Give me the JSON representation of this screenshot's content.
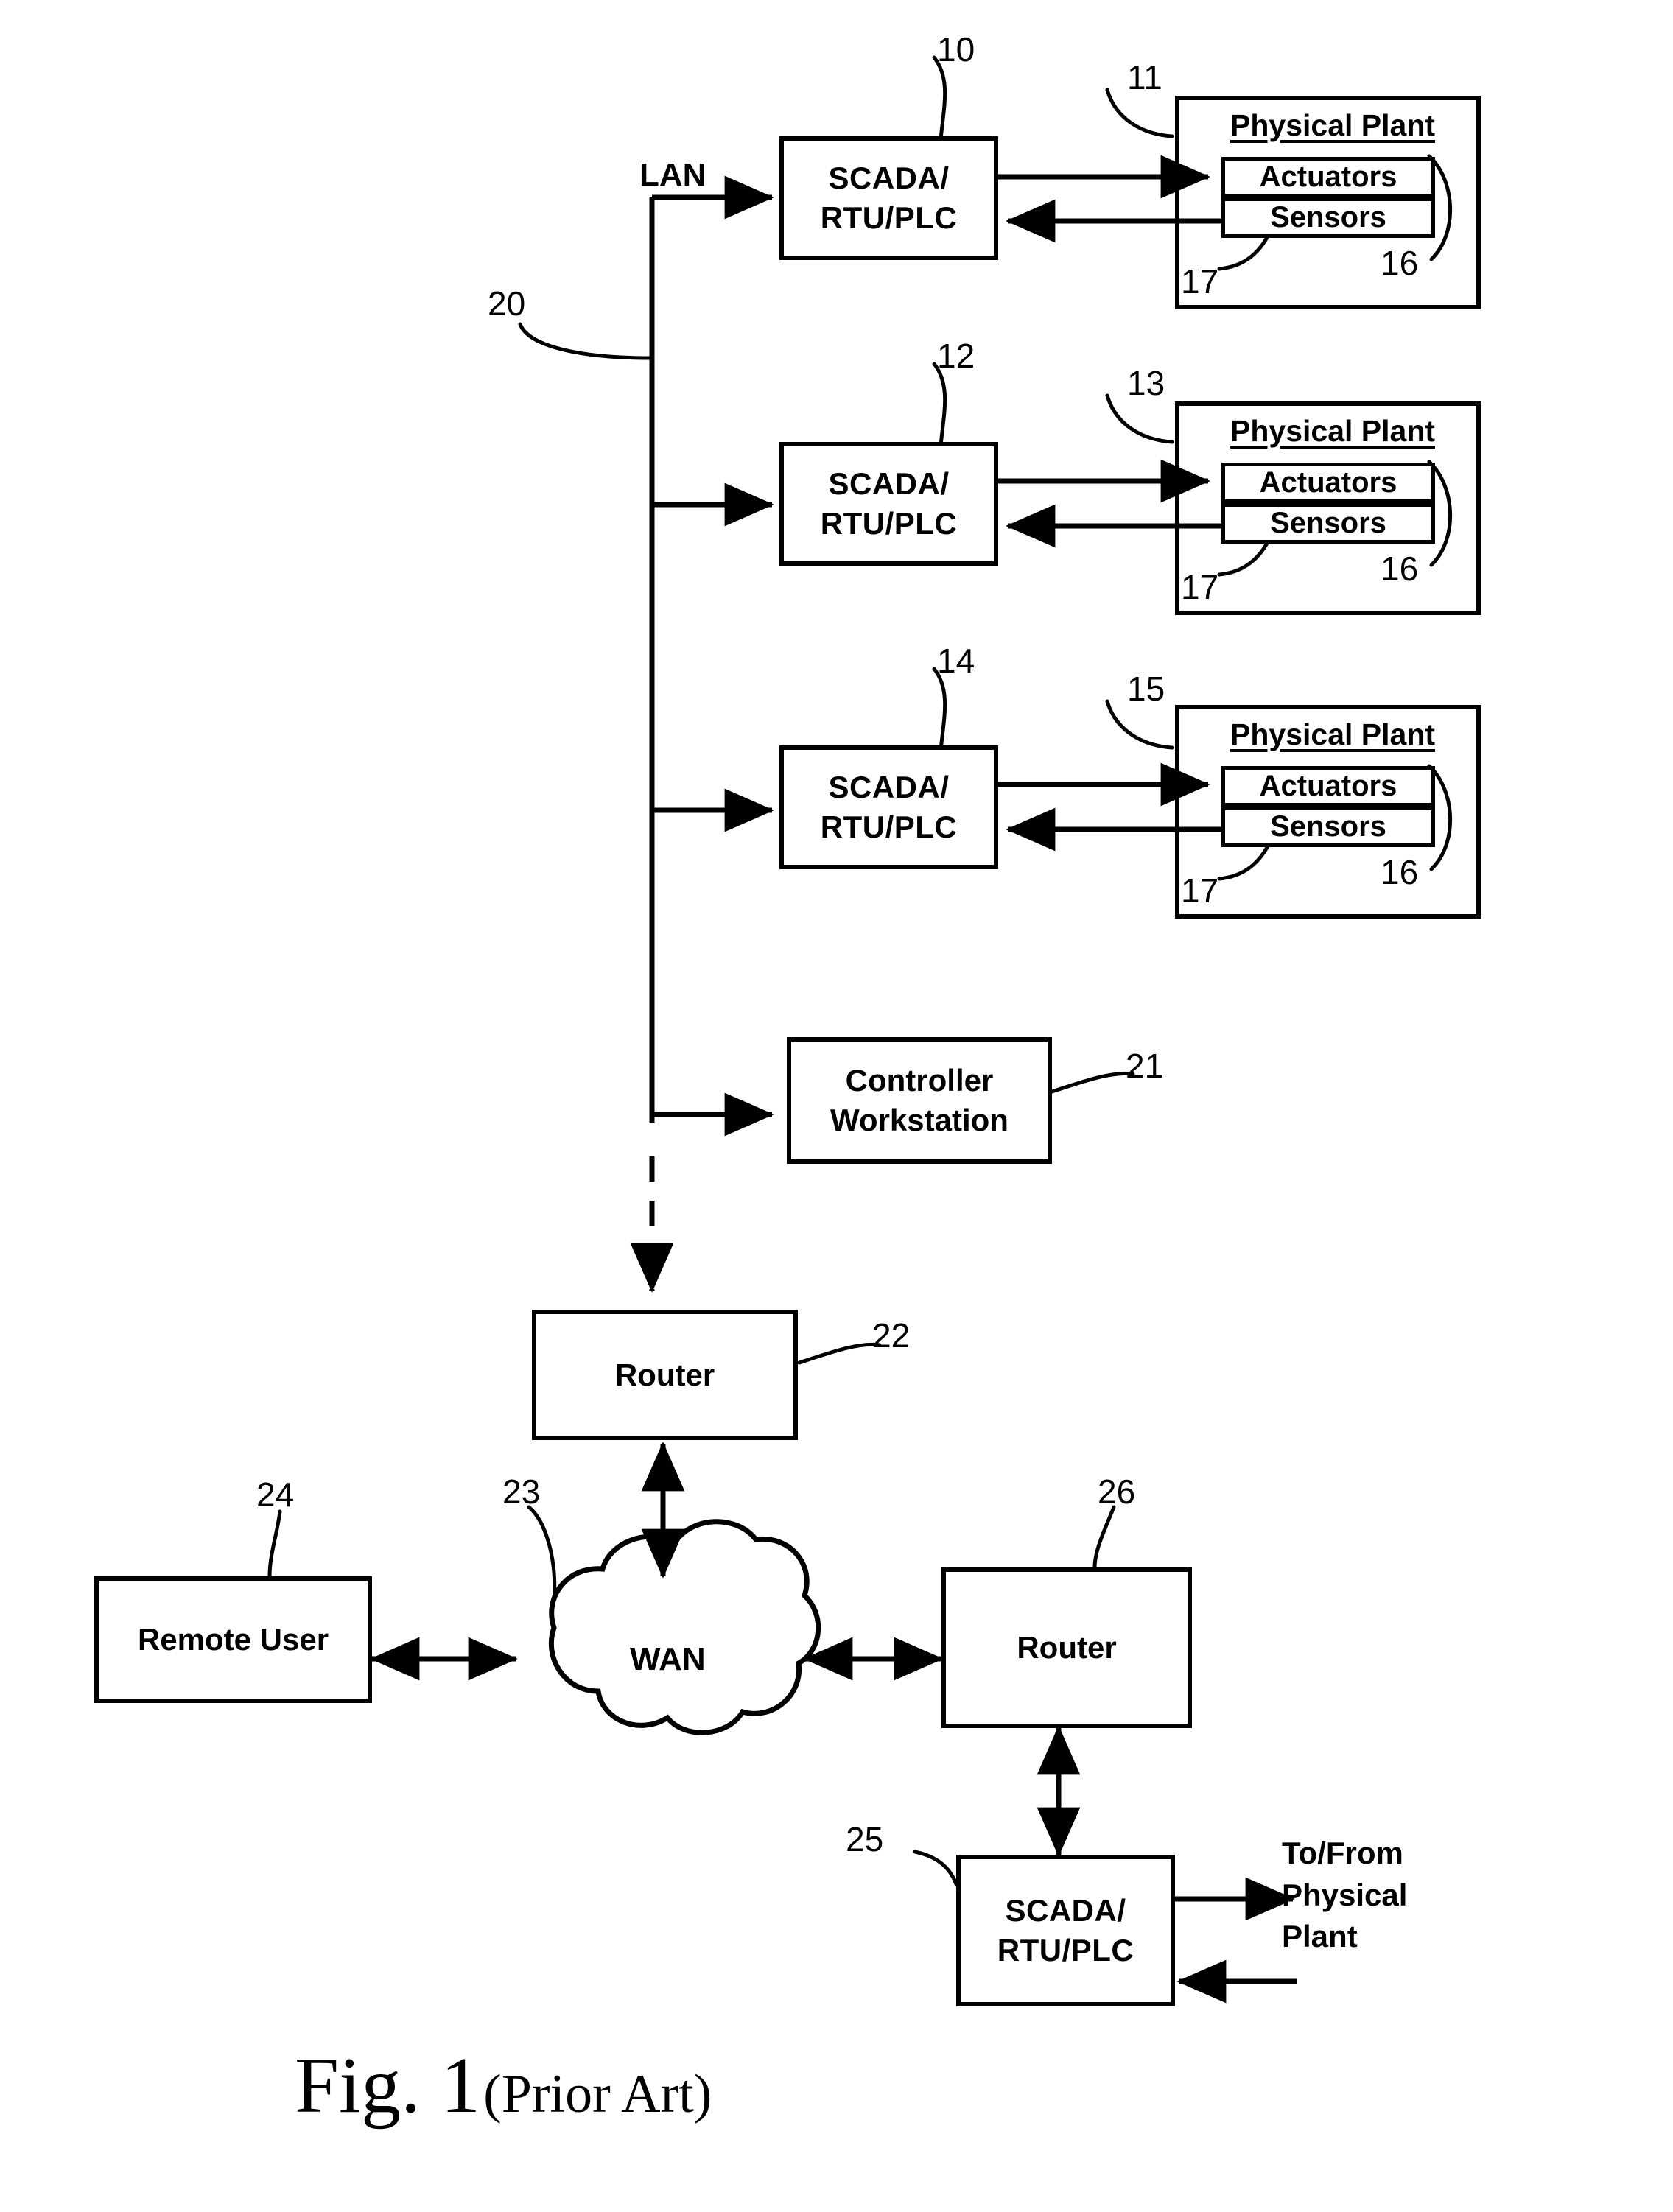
{
  "figure": {
    "caption_main": "Fig. 1",
    "caption_sub": "(Prior Art)"
  },
  "network": {
    "lan_label": "LAN",
    "lan_ref": "20"
  },
  "scada_units": [
    {
      "id": "scada-1",
      "line1": "SCADA/",
      "line2": "RTU/PLC",
      "ref": "10",
      "plant": {
        "title": "Physical Plant",
        "ref": "11",
        "actuators": "Actuators",
        "sensors": "Sensors",
        "actuators_ref": "16",
        "sensors_ref": "17"
      }
    },
    {
      "id": "scada-2",
      "line1": "SCADA/",
      "line2": "RTU/PLC",
      "ref": "12",
      "plant": {
        "title": "Physical Plant",
        "ref": "13",
        "actuators": "Actuators",
        "sensors": "Sensors",
        "actuators_ref": "16",
        "sensors_ref": "17"
      }
    },
    {
      "id": "scada-3",
      "line1": "SCADA/",
      "line2": "RTU/PLC",
      "ref": "14",
      "plant": {
        "title": "Physical Plant",
        "ref": "15",
        "actuators": "Actuators",
        "sensors": "Sensors",
        "actuators_ref": "16",
        "sensors_ref": "17"
      }
    }
  ],
  "controller_workstation": {
    "line1": "Controller",
    "line2": "Workstation",
    "ref": "21"
  },
  "router_local": {
    "label": "Router",
    "ref": "22"
  },
  "wan": {
    "label": "WAN",
    "ref": "23"
  },
  "remote_user": {
    "label": "Remote User",
    "ref": "24"
  },
  "router_remote": {
    "label": "Router",
    "ref": "26"
  },
  "scada_remote": {
    "line1": "SCADA/",
    "line2": "RTU/PLC",
    "ref": "25"
  },
  "physical_plant_io": {
    "line1": "To/From",
    "line2": "Physical",
    "line3": "Plant"
  },
  "colors": {
    "ink": "#000000",
    "paper": "#ffffff"
  }
}
